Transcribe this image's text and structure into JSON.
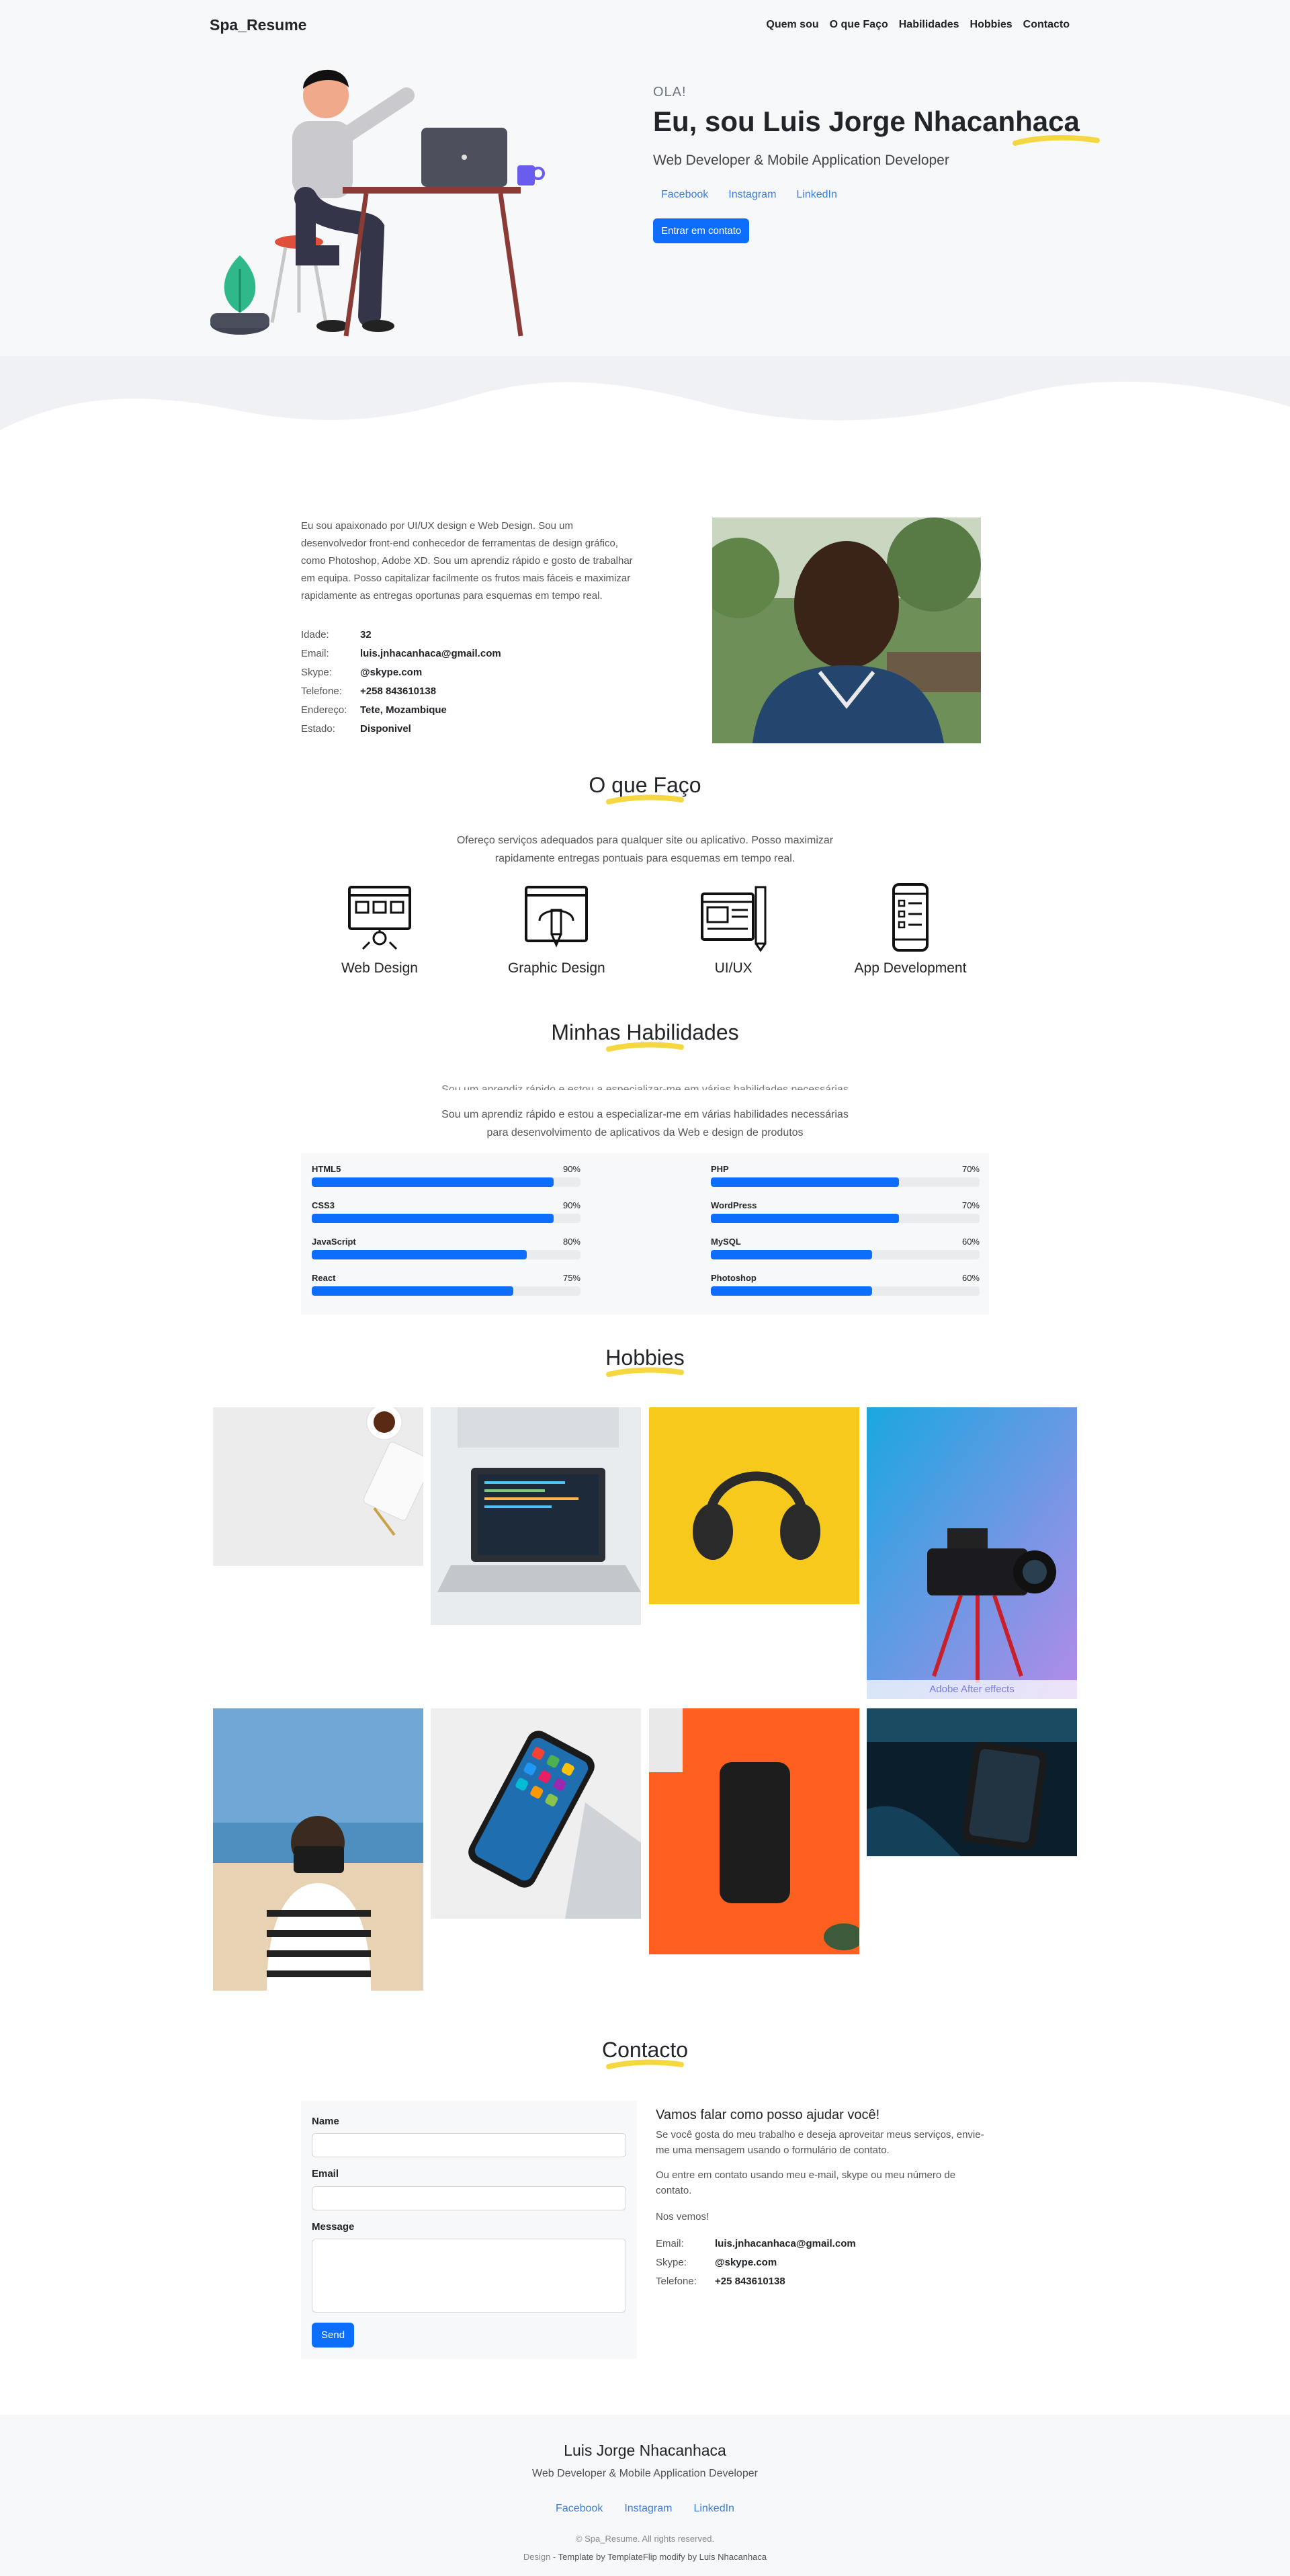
{
  "nav": {
    "brand": "Spa_Resume",
    "links": [
      "Quem sou",
      "O que Faço",
      "Habilidades",
      "Hobbies",
      "Contacto"
    ]
  },
  "hero": {
    "hello": "OLA!",
    "name": "Eu, sou Luis Jorge Nhacanhaca",
    "subtitle": "Web Developer & Mobile Application Developer",
    "social": [
      "Facebook",
      "Instagram",
      "LinkedIn"
    ],
    "cta": "Entrar em contato"
  },
  "about": {
    "text": "Eu sou apaixonado por UI/UX design e Web Design. Sou um desenvolvedor front-end conhecedor de ferramentas de design gráfico, como Photoshop, Adobe XD. Sou um aprendiz rápido e gosto de trabalhar em equipa. Posso capitalizar facilmente os frutos mais fáceis e maximizar rapidamente as entregas oportunas para esquemas em tempo real.",
    "info": [
      {
        "label": "Idade:",
        "value": "32"
      },
      {
        "label": "Email:",
        "value": "luis.jnhacanhaca@gmail.com"
      },
      {
        "label": "Skype:",
        "value": "@skype.com"
      },
      {
        "label": "Telefone:",
        "value": "+258 843610138"
      },
      {
        "label": "Endereço:",
        "value": "Tete, Mozambique"
      },
      {
        "label": "Estado:",
        "value": "Disponivel"
      }
    ]
  },
  "services": {
    "title": "O que Faço",
    "desc_line1": "Ofereço serviços adequados para qualquer site ou aplicativo. Posso maximizar",
    "desc_line2": "rapidamente entregas pontuais para esquemas em tempo real.",
    "items": [
      "Web Design",
      "Graphic Design",
      "UI/UX",
      "App Development"
    ]
  },
  "skills": {
    "title": "Minhas Habilidades",
    "desc_line1": "Sou um aprendiz rápido e estou a especializar-me em várias habilidades necessárias",
    "desc_line2": "para desenvolvimento de aplicativos da Web e design de produtos",
    "left": [
      {
        "name": "HTML5",
        "pct": "90%",
        "value": 90
      },
      {
        "name": "CSS3",
        "pct": "90%",
        "value": 90
      },
      {
        "name": "JavaScript",
        "pct": "80%",
        "value": 80
      },
      {
        "name": "React",
        "pct": "75%",
        "value": 75
      }
    ],
    "right": [
      {
        "name": "PHP",
        "pct": "70%",
        "value": 70
      },
      {
        "name": "WordPress",
        "pct": "70%",
        "value": 70
      },
      {
        "name": "MySQL",
        "pct": "60%",
        "value": 60
      },
      {
        "name": "Photoshop",
        "pct": "60%",
        "value": 60
      }
    ]
  },
  "hobbies": {
    "title": "Hobbies",
    "caption": "Adobe After effects"
  },
  "contact": {
    "title": "Contacto",
    "form": {
      "name_label": "Name",
      "email_label": "Email",
      "message_label": "Message",
      "send": "Send"
    },
    "heading": "Vamos falar como posso ajudar você!",
    "p1": "Se você gosta do meu trabalho e deseja aproveitar meus serviços, envie-me uma mensagem usando o formulário de contato.",
    "p2": "Ou entre em contato usando meu e-mail, skype ou meu número de contato.",
    "p3": "Nos vemos!",
    "rows": [
      {
        "label": "Email:",
        "value": "luis.jnhacanhaca@gmail.com"
      },
      {
        "label": "Skype:",
        "value": "@skype.com"
      },
      {
        "label": "Telefone:",
        "value": "+25 843610138"
      }
    ]
  },
  "footer": {
    "name": "Luis Jorge Nhacanhaca",
    "subtitle": "Web Developer & Mobile Application Developer",
    "social": [
      "Facebook",
      "Instagram",
      "LinkedIn"
    ],
    "copyright": "© Spa_Resume. All rights reserved.",
    "design_prefix": "Design - ",
    "design_credit": "Template by TemplateFlip modify by Luis Nhacanhaca"
  },
  "colors": {
    "accent": "#0d6efd",
    "highlight": "#f5d742",
    "background": "#f7f8fa"
  }
}
